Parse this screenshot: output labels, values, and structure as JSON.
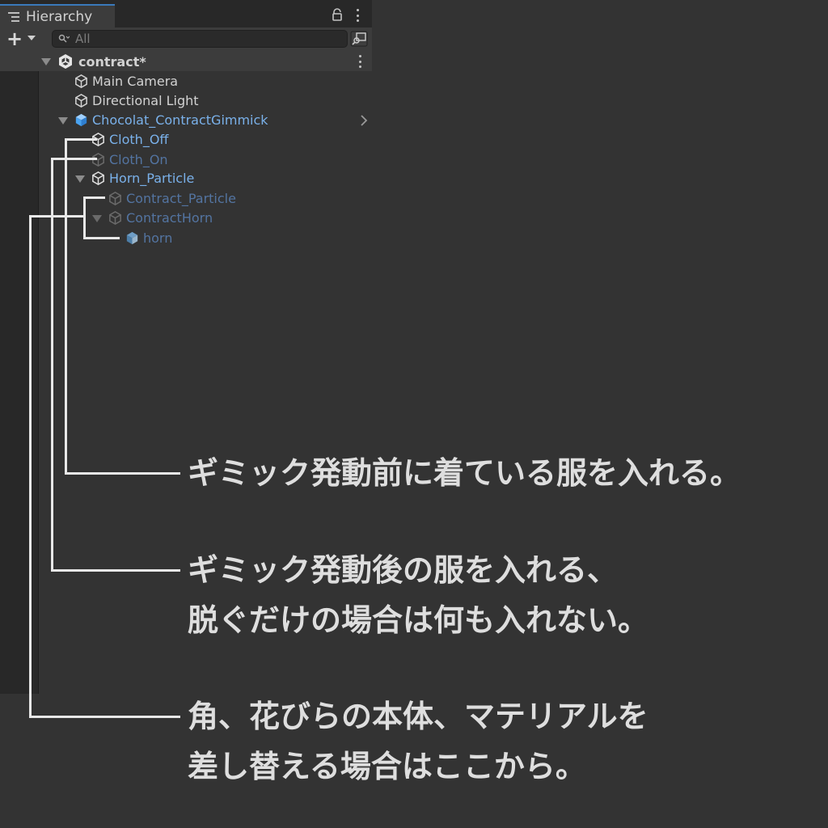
{
  "hierarchy": {
    "tab_label": "Hierarchy",
    "search_placeholder": "All",
    "add_label": "+",
    "scene": {
      "name": "contract*"
    },
    "items": [
      {
        "label": "Main Camera"
      },
      {
        "label": "Directional Light"
      },
      {
        "label": "Chocolat_ContractGimmick"
      },
      {
        "label": "Cloth_Off"
      },
      {
        "label": "Cloth_On"
      },
      {
        "label": "Horn_Particle"
      },
      {
        "label": "Contract_Particle"
      },
      {
        "label": "ContractHorn"
      },
      {
        "label": "horn"
      }
    ]
  },
  "annotations": [
    {
      "lines": [
        "ギミック発動前に着ている服を入れる。"
      ]
    },
    {
      "lines": [
        "ギミック発動後の服を入れる、",
        "脱ぐだけの場合は何も入れない。"
      ]
    },
    {
      "lines": [
        "角、花びらの本体、マテリアルを",
        "差し替える場合はここから。"
      ]
    }
  ],
  "colors": {
    "background": "#333333",
    "panel": "#282828",
    "text_active_blue": "#7ab1ea",
    "text_inactive_blue": "#5374a1",
    "annotation_text": "#dedede"
  }
}
